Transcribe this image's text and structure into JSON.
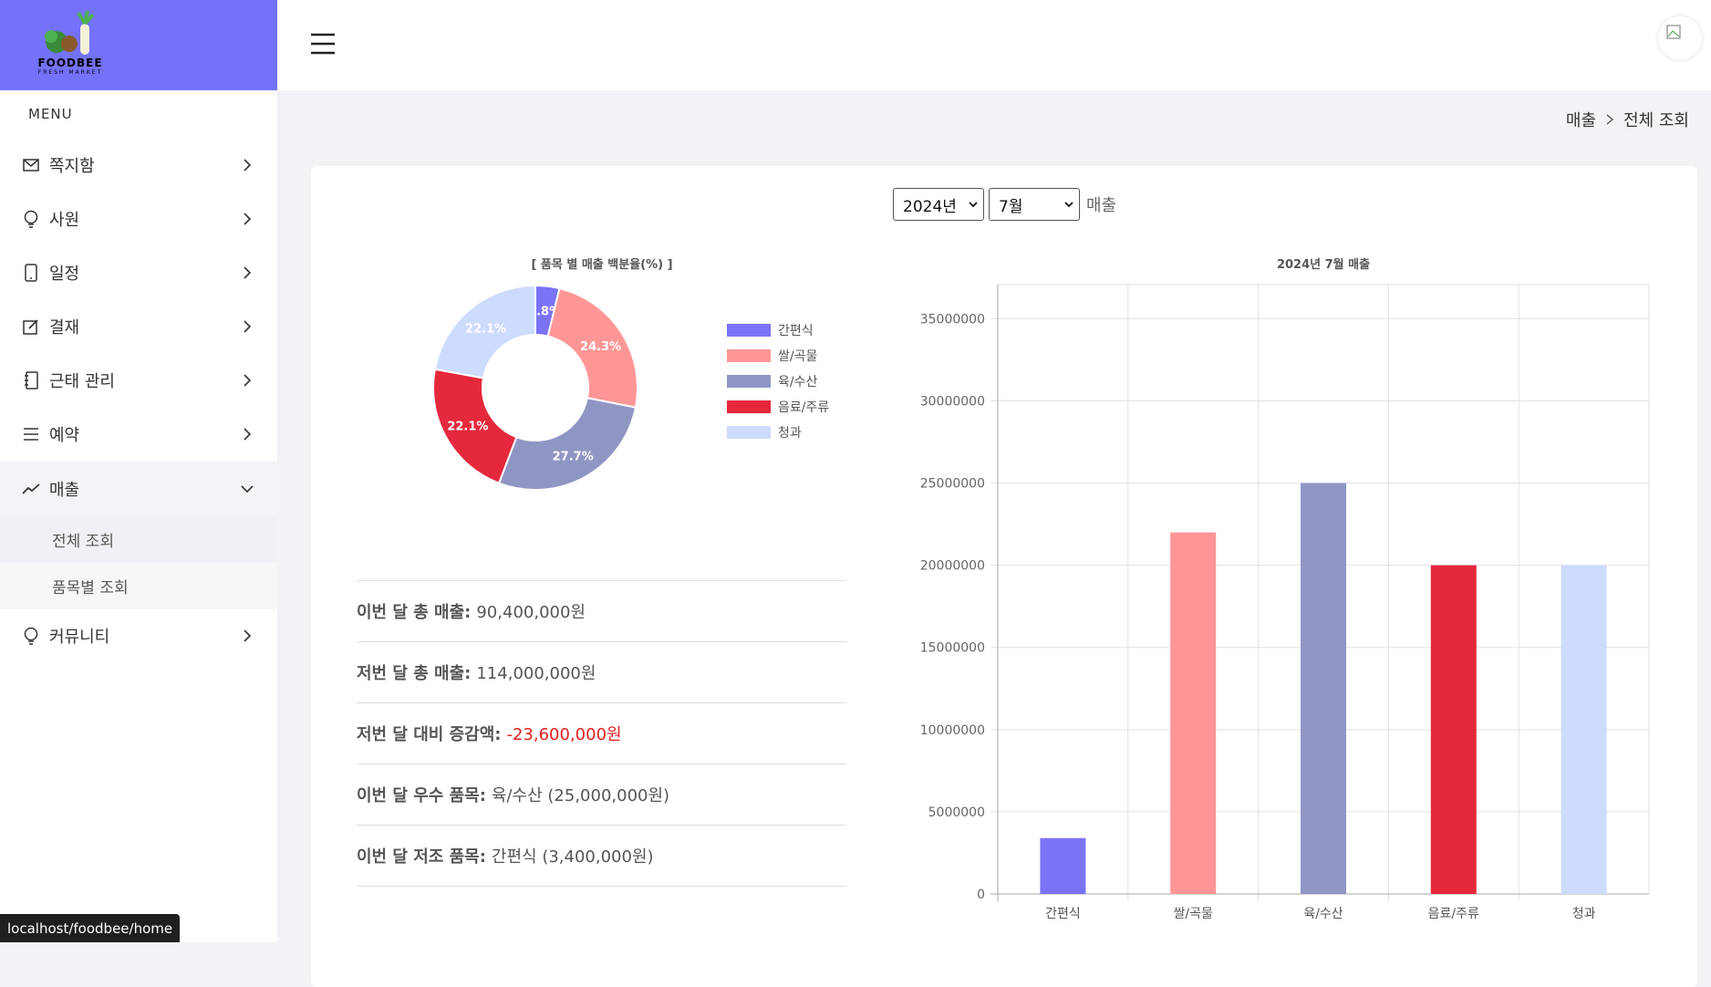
{
  "brand": {
    "name": "FOODBEE",
    "tagline": "FRESH MARKET",
    "color": "#7471fb"
  },
  "sidebar": {
    "menu_title": "MENU",
    "items": [
      {
        "label": "쪽지함",
        "icon": "mail-icon"
      },
      {
        "label": "사원",
        "icon": "bulb-icon"
      },
      {
        "label": "일정",
        "icon": "phone-icon"
      },
      {
        "label": "결재",
        "icon": "edit-icon"
      },
      {
        "label": "근태 관리",
        "icon": "notebook-icon"
      },
      {
        "label": "예약",
        "icon": "list-icon"
      },
      {
        "label": "매출",
        "icon": "chart-line-icon",
        "expanded": true
      },
      {
        "label": "커뮤니티",
        "icon": "bulb-icon"
      }
    ],
    "subitems": [
      "전체 조회",
      "품목별 조회"
    ]
  },
  "breadcrumb": {
    "parent": "매출",
    "current": "전체 조회"
  },
  "controls": {
    "year": "2024년",
    "month": "7월",
    "label": "매출"
  },
  "stats": [
    {
      "key": "이번 달 총 매출:",
      "value": "90,400,000원"
    },
    {
      "key": "저번 달 총 매출:",
      "value": "114,000,000원"
    },
    {
      "key": "저번 달 대비 증감액:",
      "value": "-23,600,000원",
      "negative": true
    },
    {
      "key": "이번 달 우수 품목:",
      "value": "육/수산 (25,000,000원)"
    },
    {
      "key": "이번 달 저조 품목:",
      "value": "간편식 (3,400,000원)"
    }
  ],
  "status_url": "localhost/foodbee/home",
  "chart_data": [
    {
      "type": "pie",
      "title": "[ 품목 별 매출 백분율(%) ]",
      "categories": [
        "간편식",
        "쌀/곡물",
        "육/수산",
        "음료/주류",
        "청과"
      ],
      "values": [
        3.8,
        24.3,
        27.7,
        22.1,
        22.1
      ],
      "value_labels": [
        "3.8%",
        "24.3%",
        "27.7%",
        "22.1%",
        "22.1%"
      ],
      "colors": [
        "#7b73f7",
        "#ff9696",
        "#9096c4",
        "#e5283c",
        "#cddbff"
      ],
      "legend": "right"
    },
    {
      "type": "bar",
      "title": "2024년 7월 매출",
      "categories": [
        "간편식",
        "쌀/곡물",
        "육/수산",
        "음료/주류",
        "청과"
      ],
      "values": [
        3400000,
        22000000,
        25000000,
        20000000,
        20000000
      ],
      "colors": [
        "#7b73f7",
        "#ff9696",
        "#9096c4",
        "#e5283c",
        "#cddbff"
      ],
      "ylim": [
        0,
        35000000
      ],
      "yticks": [
        0,
        5000000,
        10000000,
        15000000,
        20000000,
        25000000,
        30000000,
        35000000
      ],
      "grid": true
    }
  ]
}
